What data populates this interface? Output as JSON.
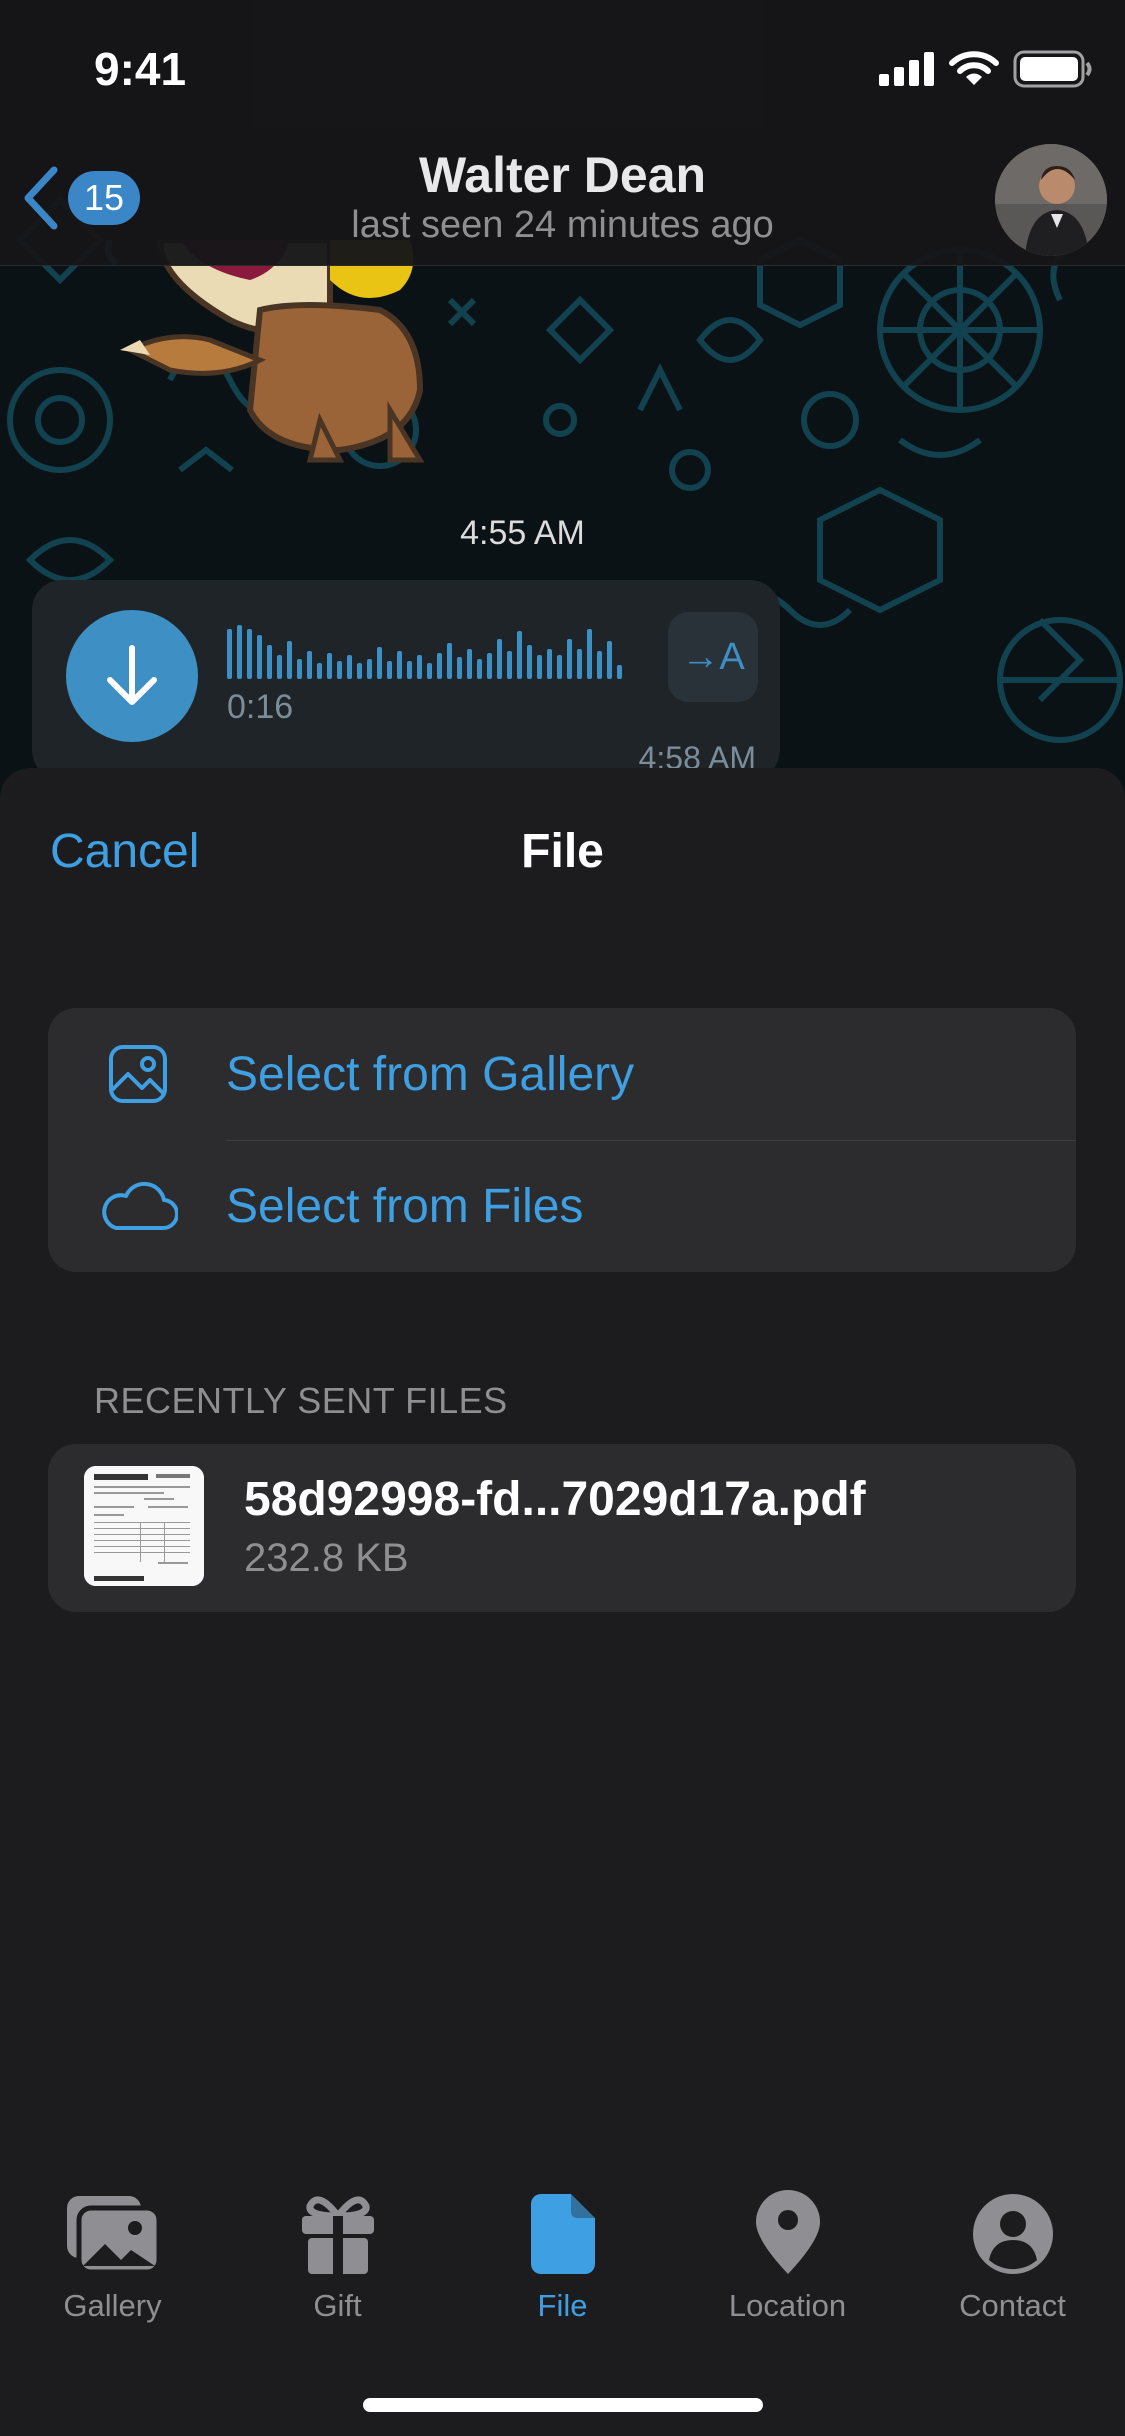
{
  "status_bar": {
    "time": "9:41"
  },
  "nav": {
    "back_count": "15",
    "title": "Walter Dean",
    "subtitle": "last seen 24 minutes ago"
  },
  "chat": {
    "sticker_time": "4:55 AM",
    "voice_message": {
      "duration": "0:16",
      "time": "4:58 AM",
      "translate_label": "→A"
    }
  },
  "sheet": {
    "cancel_label": "Cancel",
    "title": "File",
    "options": [
      {
        "label": "Select from Gallery",
        "icon": "gallery-icon"
      },
      {
        "label": "Select from Files",
        "icon": "cloud-icon"
      }
    ],
    "recent_header": "RECENTLY SENT FILES",
    "recent_files": [
      {
        "name": "58d92998-fd...7029d17a.pdf",
        "size": "232.8 KB"
      }
    ]
  },
  "tabs": [
    {
      "label": "Gallery",
      "icon": "gallery-icon",
      "active": false
    },
    {
      "label": "Gift",
      "icon": "gift-icon",
      "active": false
    },
    {
      "label": "File",
      "icon": "file-icon",
      "active": true
    },
    {
      "label": "Location",
      "icon": "location-pin-icon",
      "active": false
    },
    {
      "label": "Contact",
      "icon": "contact-icon",
      "active": false
    }
  ],
  "colors": {
    "accent": "#3e9fe3",
    "sheet_bg": "#1c1c1e",
    "card_bg": "#2c2c2e",
    "secondary_text": "#8e8e93"
  }
}
